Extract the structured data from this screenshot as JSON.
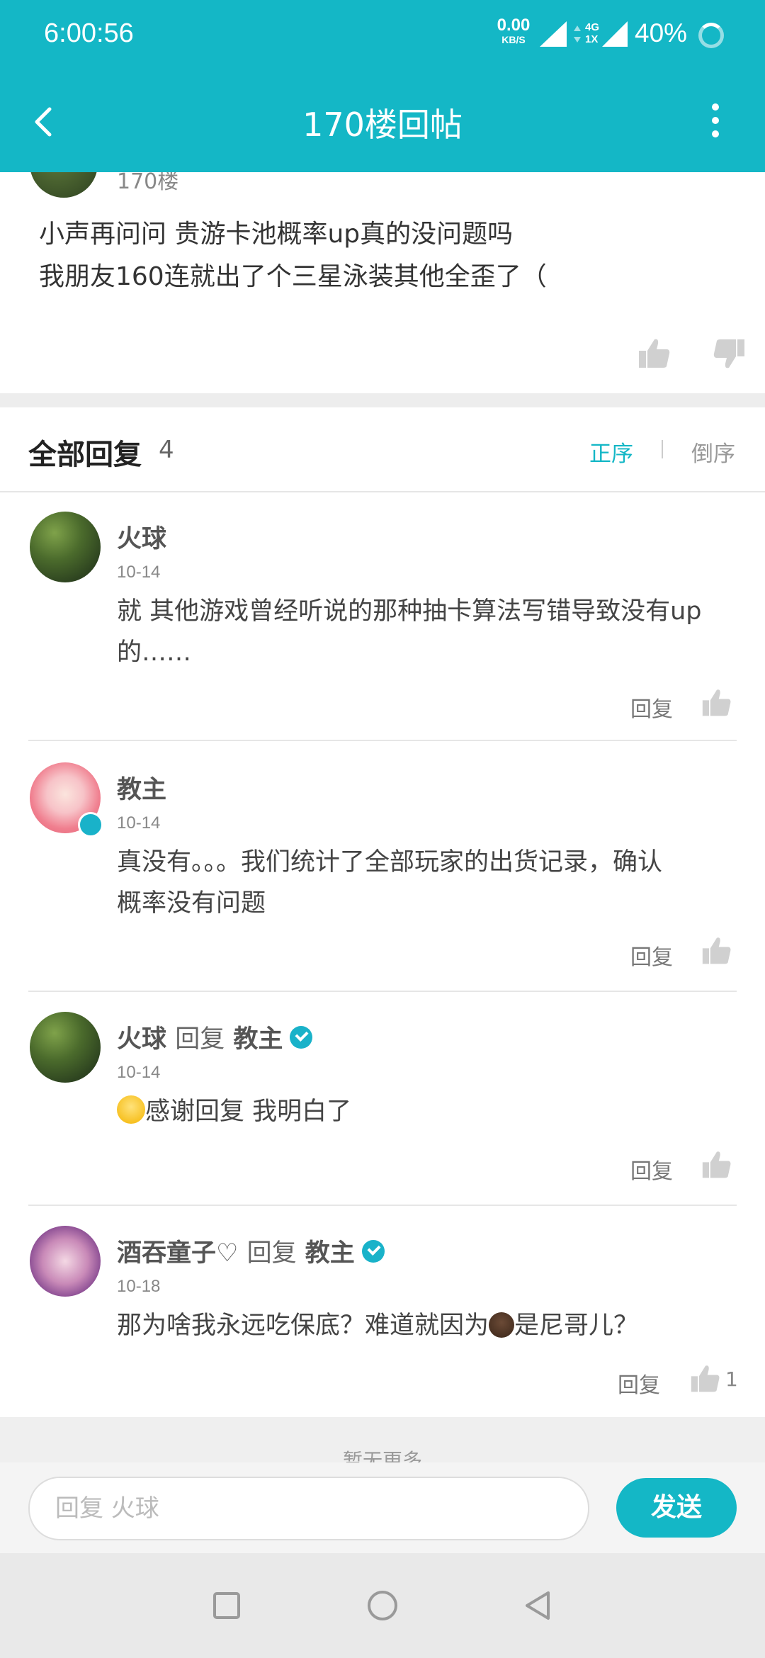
{
  "status_bar": {
    "time": "6:00:56",
    "net_speed": "0.00",
    "net_speed_unit": "KB/S",
    "network_4g": "4G",
    "network_1x": "1X",
    "battery": "40%"
  },
  "header": {
    "title": "170楼回帖",
    "back_icon": "chevron-left-icon",
    "menu_icon": "more-vertical-icon"
  },
  "post": {
    "floor": "170楼",
    "line1": "小声再问问 贵游卡池概率up真的没问题吗",
    "line2": "我朋友160连就出了个三星泳装其他全歪了（"
  },
  "replies_header": {
    "label": "全部回复",
    "count": "4",
    "sort_asc": "正序",
    "sort_desc": "倒序"
  },
  "replies": [
    {
      "name": "火球",
      "date": "10-14",
      "line1": "就 其他游戏曾经听说的那种抽卡算法写错导致没有up",
      "line2": "的……",
      "reply_label": "回复"
    },
    {
      "name": "教主",
      "date": "10-14",
      "line1": "真没有。。。我们统计了全部玩家的出货记录，确认",
      "line2": "概率没有问题",
      "reply_label": "回复"
    },
    {
      "name": "火球",
      "reply_word": "回复",
      "target": "教主",
      "date": "10-14",
      "line1": "感谢回复 我明白了",
      "reply_label": "回复"
    },
    {
      "name": "酒吞童子♡",
      "reply_word": "回复",
      "target": "教主",
      "date": "10-18",
      "line1a": "那为啥我永远吃保底？难道就因为",
      "line1b": "是尼哥儿？",
      "reply_label": "回复",
      "likes": "1"
    }
  ],
  "footer": {
    "more_text": "暂无更多"
  },
  "input": {
    "placeholder": "回复 火球",
    "send_label": "发送"
  },
  "colors": {
    "accent": "#14b7c6"
  }
}
